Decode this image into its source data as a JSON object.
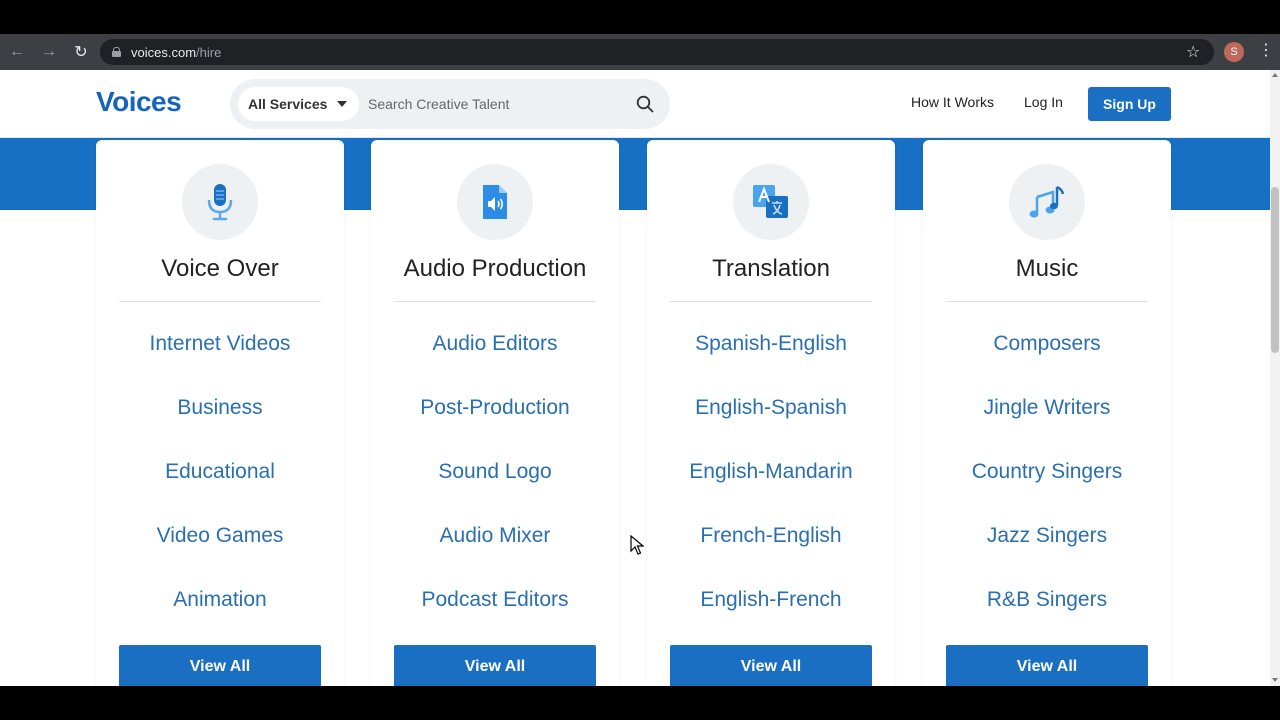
{
  "browser": {
    "url_host": "voices.com",
    "url_path": "/hire",
    "profile_initial": "S",
    "icons": [
      "back-icon",
      "forward-icon",
      "reload-icon",
      "lock-icon",
      "star-icon",
      "menu-icon"
    ]
  },
  "header": {
    "logo": "Voices",
    "service_select": "All Services",
    "search_placeholder": "Search Creative Talent",
    "nav": {
      "how_it_works": "How It Works",
      "log_in": "Log In",
      "sign_up": "Sign Up"
    }
  },
  "colors": {
    "brand_blue": "#1a6fc2",
    "link_blue": "#2a6fb0",
    "hero_band": "#1770c3"
  },
  "categories": [
    {
      "title": "Voice Over",
      "icon": "microphone-icon",
      "links": [
        "Internet Videos",
        "Business",
        "Educational",
        "Video Games",
        "Animation"
      ],
      "button": "View All"
    },
    {
      "title": "Audio Production",
      "icon": "audio-file-icon",
      "links": [
        "Audio Editors",
        "Post-Production",
        "Sound Logo",
        "Audio Mixer",
        "Podcast Editors"
      ],
      "button": "View All"
    },
    {
      "title": "Translation",
      "icon": "translate-icon",
      "links": [
        "Spanish-English",
        "English-Spanish",
        "English-Mandarin",
        "French-English",
        "English-French"
      ],
      "button": "View All"
    },
    {
      "title": "Music",
      "icon": "music-note-icon",
      "links": [
        "Composers",
        "Jingle Writers",
        "Country Singers",
        "Jazz Singers",
        "R&B Singers"
      ],
      "button": "View All"
    }
  ]
}
